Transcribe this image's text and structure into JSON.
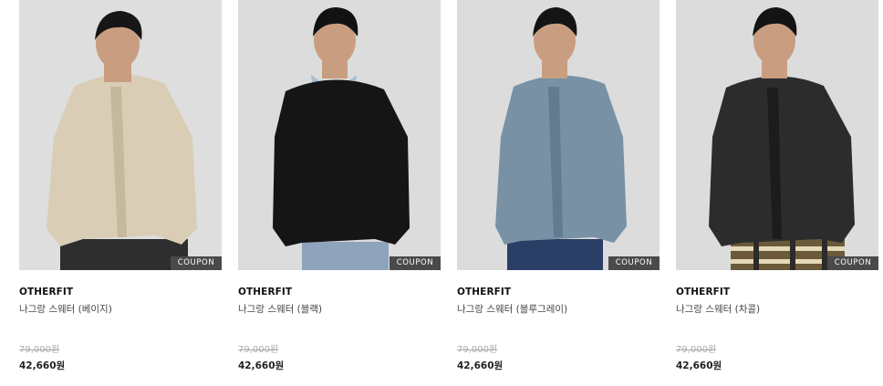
{
  "products": [
    {
      "brand": "OTHERFIT",
      "name": "나그랑 스웨터 (베이지)",
      "original_price": "79,000원",
      "sale_price": "42,660원",
      "badge": "COUPON",
      "sweater_color": "#d9cdb6",
      "sweater_shade": "#c6b89d"
    },
    {
      "brand": "OTHERFIT",
      "name": "나그랑 스웨터 (블랙)",
      "original_price": "79,000원",
      "sale_price": "42,660원",
      "badge": "COUPON",
      "sweater_color": "#151515",
      "sweater_shade": "#0a0a0a"
    },
    {
      "brand": "OTHERFIT",
      "name": "나그랑 스웨터 (블루그레이)",
      "original_price": "79,000원",
      "sale_price": "42,660원",
      "badge": "COUPON",
      "sweater_color": "#7891a5",
      "sweater_shade": "#627b90"
    },
    {
      "brand": "OTHERFIT",
      "name": "나그랑 스웨터 (차콜)",
      "original_price": "79,000원",
      "sale_price": "42,660원",
      "badge": "COUPON",
      "sweater_color": "#2c2c2c",
      "sweater_shade": "#1c1c1c"
    }
  ]
}
